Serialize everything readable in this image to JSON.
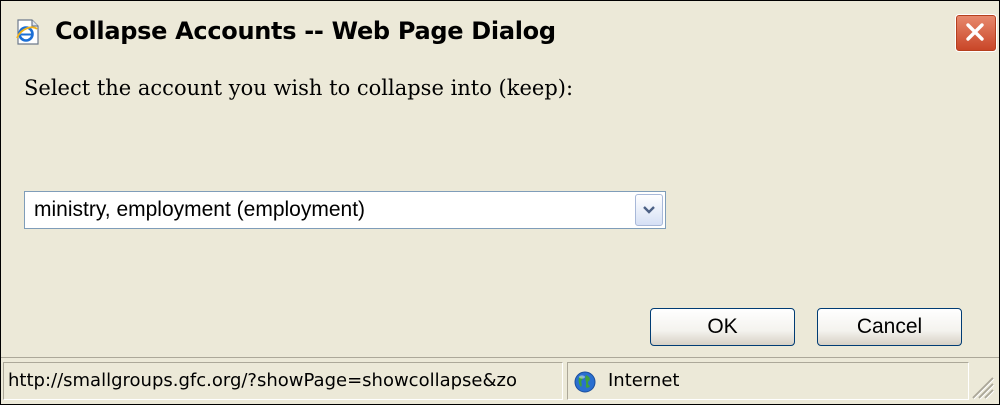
{
  "window": {
    "title": "Collapse Accounts -- Web Page Dialog",
    "icon": "ie-page-icon",
    "close_icon": "close-icon"
  },
  "dialog": {
    "prompt": "Select the account you wish to collapse into (keep):",
    "account_select": {
      "selected_value": "ministry, employment (employment)",
      "arrow_icon": "chevron-down-icon"
    },
    "ok_label": "OK",
    "cancel_label": "Cancel"
  },
  "statusbar": {
    "url": "http://smallgroups.gfc.org/?showPage=showcollapse&zo",
    "zone_icon": "globe-icon",
    "zone_label": "Internet"
  },
  "colors": {
    "window_bg": "#ECE9D8",
    "close_button": "#C84426",
    "button_border": "#003C74",
    "select_border": "#7F9DB9"
  }
}
